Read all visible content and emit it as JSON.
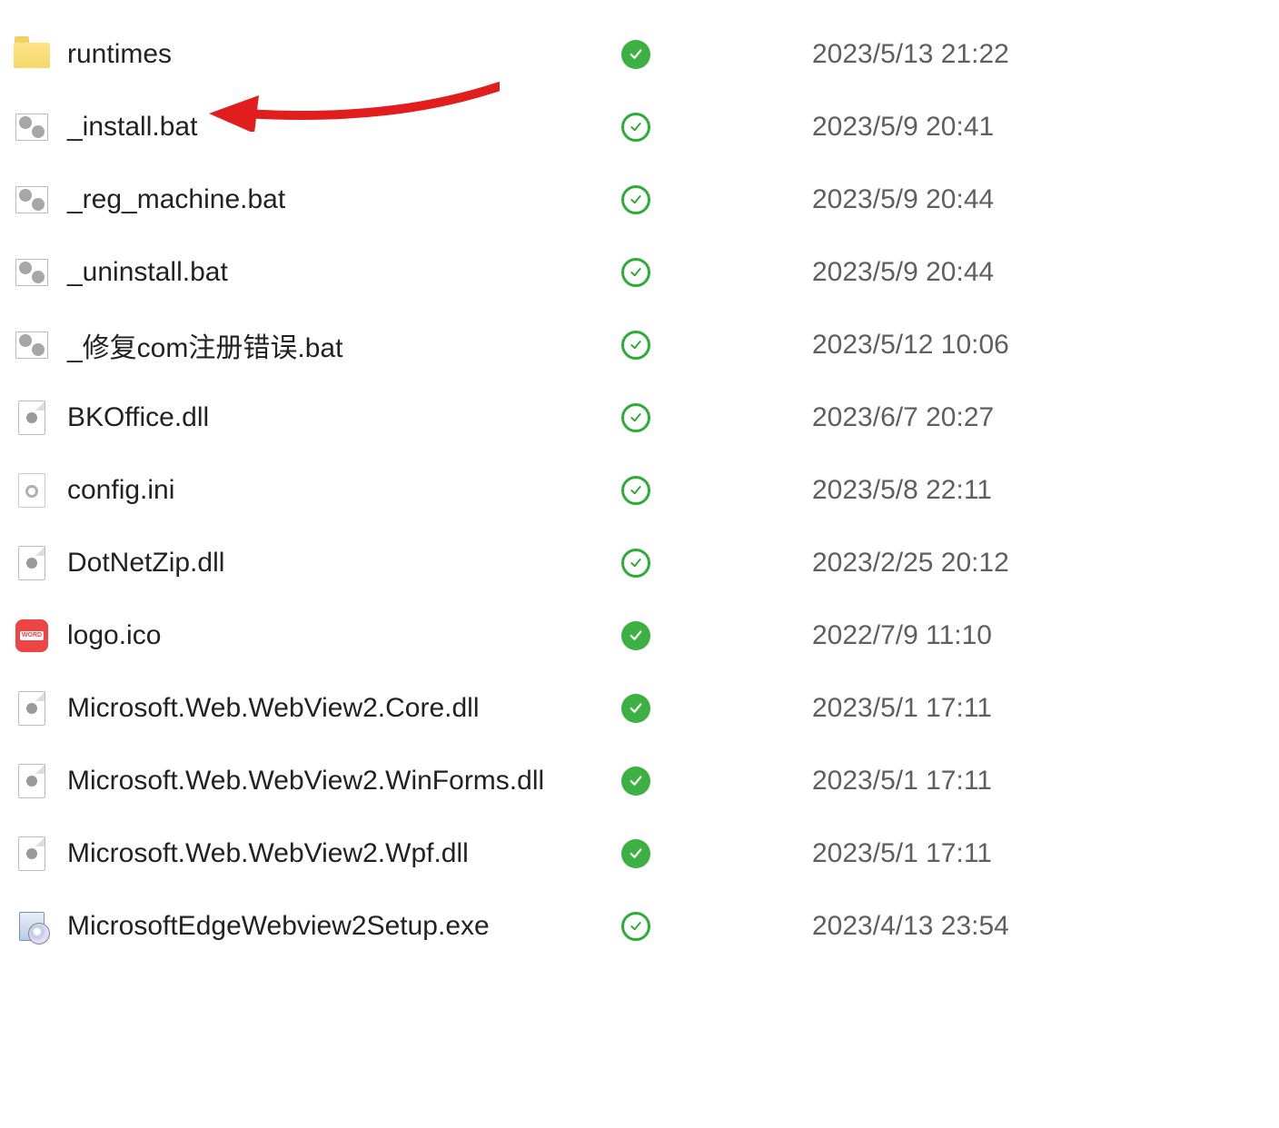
{
  "colors": {
    "status_solid": "#3cb043",
    "status_outline": "#2eac3a",
    "annotation": "#e11d1d"
  },
  "files": [
    {
      "icon": "folder",
      "name": "runtimes",
      "status": "solid",
      "date": "2023/5/13 21:22"
    },
    {
      "icon": "bat",
      "name": "_install.bat",
      "status": "outline",
      "date": "2023/5/9 20:41"
    },
    {
      "icon": "bat",
      "name": "_reg_machine.bat",
      "status": "outline",
      "date": "2023/5/9 20:44"
    },
    {
      "icon": "bat",
      "name": "_uninstall.bat",
      "status": "outline",
      "date": "2023/5/9 20:44"
    },
    {
      "icon": "bat",
      "name": "_修复com注册错误.bat",
      "status": "outline",
      "date": "2023/5/12 10:06"
    },
    {
      "icon": "dll",
      "name": "BKOffice.dll",
      "status": "outline",
      "date": "2023/6/7 20:27"
    },
    {
      "icon": "ini",
      "name": "config.ini",
      "status": "outline",
      "date": "2023/5/8 22:11"
    },
    {
      "icon": "dll",
      "name": "DotNetZip.dll",
      "status": "outline",
      "date": "2023/2/25 20:12"
    },
    {
      "icon": "icofile",
      "name": "logo.ico",
      "status": "solid",
      "date": "2022/7/9 11:10"
    },
    {
      "icon": "dll",
      "name": "Microsoft.Web.WebView2.Core.dll",
      "status": "solid",
      "date": "2023/5/1 17:11"
    },
    {
      "icon": "dll",
      "name": "Microsoft.Web.WebView2.WinForms.dll",
      "status": "solid",
      "date": "2023/5/1 17:11"
    },
    {
      "icon": "dll",
      "name": "Microsoft.Web.WebView2.Wpf.dll",
      "status": "solid",
      "date": "2023/5/1 17:11"
    },
    {
      "icon": "exe",
      "name": "MicrosoftEdgeWebview2Setup.exe",
      "status": "outline",
      "date": "2023/4/13 23:54"
    }
  ],
  "annotation": {
    "type": "arrow",
    "target_row": 1
  }
}
